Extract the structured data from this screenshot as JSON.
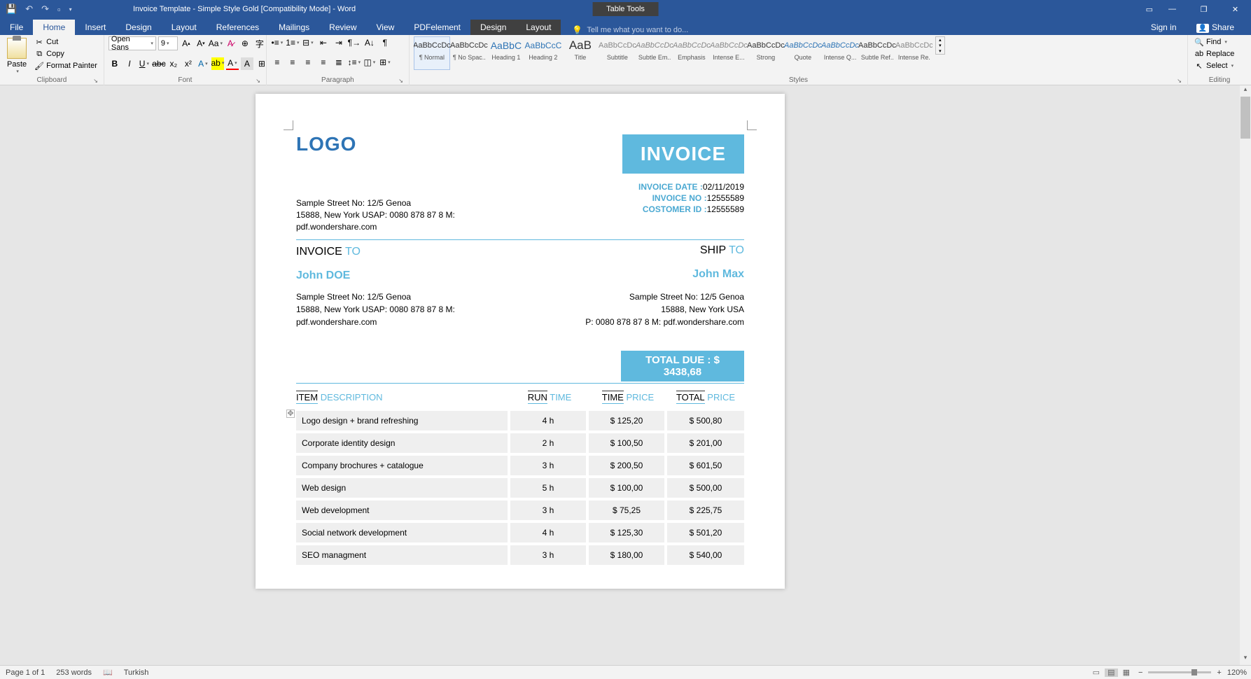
{
  "titlebar": {
    "doc_title": "Invoice Template - Simple Style Gold [Compatibility Mode] - Word",
    "table_tools": "Table Tools"
  },
  "tabs": {
    "file": "File",
    "home": "Home",
    "insert": "Insert",
    "design": "Design",
    "layout": "Layout",
    "references": "References",
    "mailings": "Mailings",
    "review": "Review",
    "view": "View",
    "pdfelement": "PDFelement",
    "tt_design": "Design",
    "tt_layout": "Layout",
    "tell_me": "Tell me what you want to do...",
    "sign_in": "Sign in",
    "share": "Share"
  },
  "ribbon": {
    "clipboard": {
      "label": "Clipboard",
      "paste": "Paste",
      "cut": "Cut",
      "copy": "Copy",
      "format_painter": "Format Painter"
    },
    "font": {
      "label": "Font",
      "name": "Open Sans",
      "size": "9"
    },
    "paragraph": {
      "label": "Paragraph"
    },
    "styles": {
      "label": "Styles",
      "items": [
        {
          "name": "¶ Normal",
          "cls": ""
        },
        {
          "name": "¶ No Spac...",
          "cls": ""
        },
        {
          "name": "Heading 1",
          "cls": "h1"
        },
        {
          "name": "Heading 2",
          "cls": "h2"
        },
        {
          "name": "Title",
          "cls": "title"
        },
        {
          "name": "Subtitle",
          "cls": "sub"
        },
        {
          "name": "Subtle Em...",
          "cls": "em"
        },
        {
          "name": "Emphasis",
          "cls": "em"
        },
        {
          "name": "Intense E...",
          "cls": "ie"
        },
        {
          "name": "Strong",
          "cls": ""
        },
        {
          "name": "Quote",
          "cls": "quote"
        },
        {
          "name": "Intense Q...",
          "cls": "iq"
        },
        {
          "name": "Subtle Ref...",
          "cls": ""
        },
        {
          "name": "Intense Re...",
          "cls": "ir"
        }
      ],
      "preview": {
        "default": "AaBbCcDc",
        "h1": "AaBbC",
        "h2": "AaBbCcC",
        "title": "AaB"
      }
    },
    "editing": {
      "label": "Editing",
      "find": "Find",
      "replace": "Replace",
      "select": "Select"
    }
  },
  "document": {
    "logo": "LOGO",
    "invoice_label": "INVOICE",
    "meta": {
      "date_lbl": "INVOICE DATE :",
      "date": "02/11/2019",
      "no_lbl": "INVOICE NO :",
      "no": "12555589",
      "cust_lbl": "COSTOMER ID :",
      "cust": "12555589"
    },
    "company_addr": [
      "Sample Street No: 12/5 Genoa",
      "15888, New York USAP: 0080 878 87 8 M:",
      "pdf.wondershare.com"
    ],
    "invoice_to_lbl": "INVOICE",
    "invoice_to_cyan": "TO",
    "ship_to_lbl": "SHIP",
    "ship_to_cyan": "TO",
    "bill_name": "John DOE",
    "ship_name": "John Max",
    "bill_addr": [
      "Sample Street No: 12/5 Genoa",
      "15888, New York USAP: 0080 878 87 8 M:",
      "pdf.wondershare.com"
    ],
    "ship_addr": [
      "Sample Street No: 12/5 Genoa",
      "15888, New York USA",
      "P: 0080 878 87 8  M: pdf.wondershare.com"
    ],
    "total_due_lbl": "TOTAL DUE :",
    "total_due_val": "$ 3438,68",
    "headers": {
      "item": "ITEM",
      "desc": "DESCRIPTION",
      "run": "RUN",
      "time": "TIME",
      "time2": "TIME",
      "price": "PRICE",
      "total": "TOTAL",
      "price2": "PRICE"
    },
    "rows": [
      {
        "desc": "Logo design + brand refreshing",
        "time": "4 h",
        "price": "$ 125,20",
        "total": "$ 500,80"
      },
      {
        "desc": "Corporate identity design",
        "time": "2 h",
        "price": "$ 100,50",
        "total": "$ 201,00"
      },
      {
        "desc": "Company brochures + catalogue",
        "time": "3 h",
        "price": "$ 200,50",
        "total": "$ 601,50"
      },
      {
        "desc": "Web design",
        "time": "5 h",
        "price": "$ 100,00",
        "total": "$ 500,00"
      },
      {
        "desc": "Web development",
        "time": "3 h",
        "price": "$ 75,25",
        "total": "$ 225,75"
      },
      {
        "desc": "Social network development",
        "time": "4 h",
        "price": "$ 125,30",
        "total": "$ 501,20"
      },
      {
        "desc": "SEO managment",
        "time": "3 h",
        "price": "$ 180,00",
        "total": "$ 540,00"
      }
    ]
  },
  "statusbar": {
    "page": "Page 1 of 1",
    "words": "253 words",
    "lang": "Turkish",
    "zoom": "120%"
  }
}
